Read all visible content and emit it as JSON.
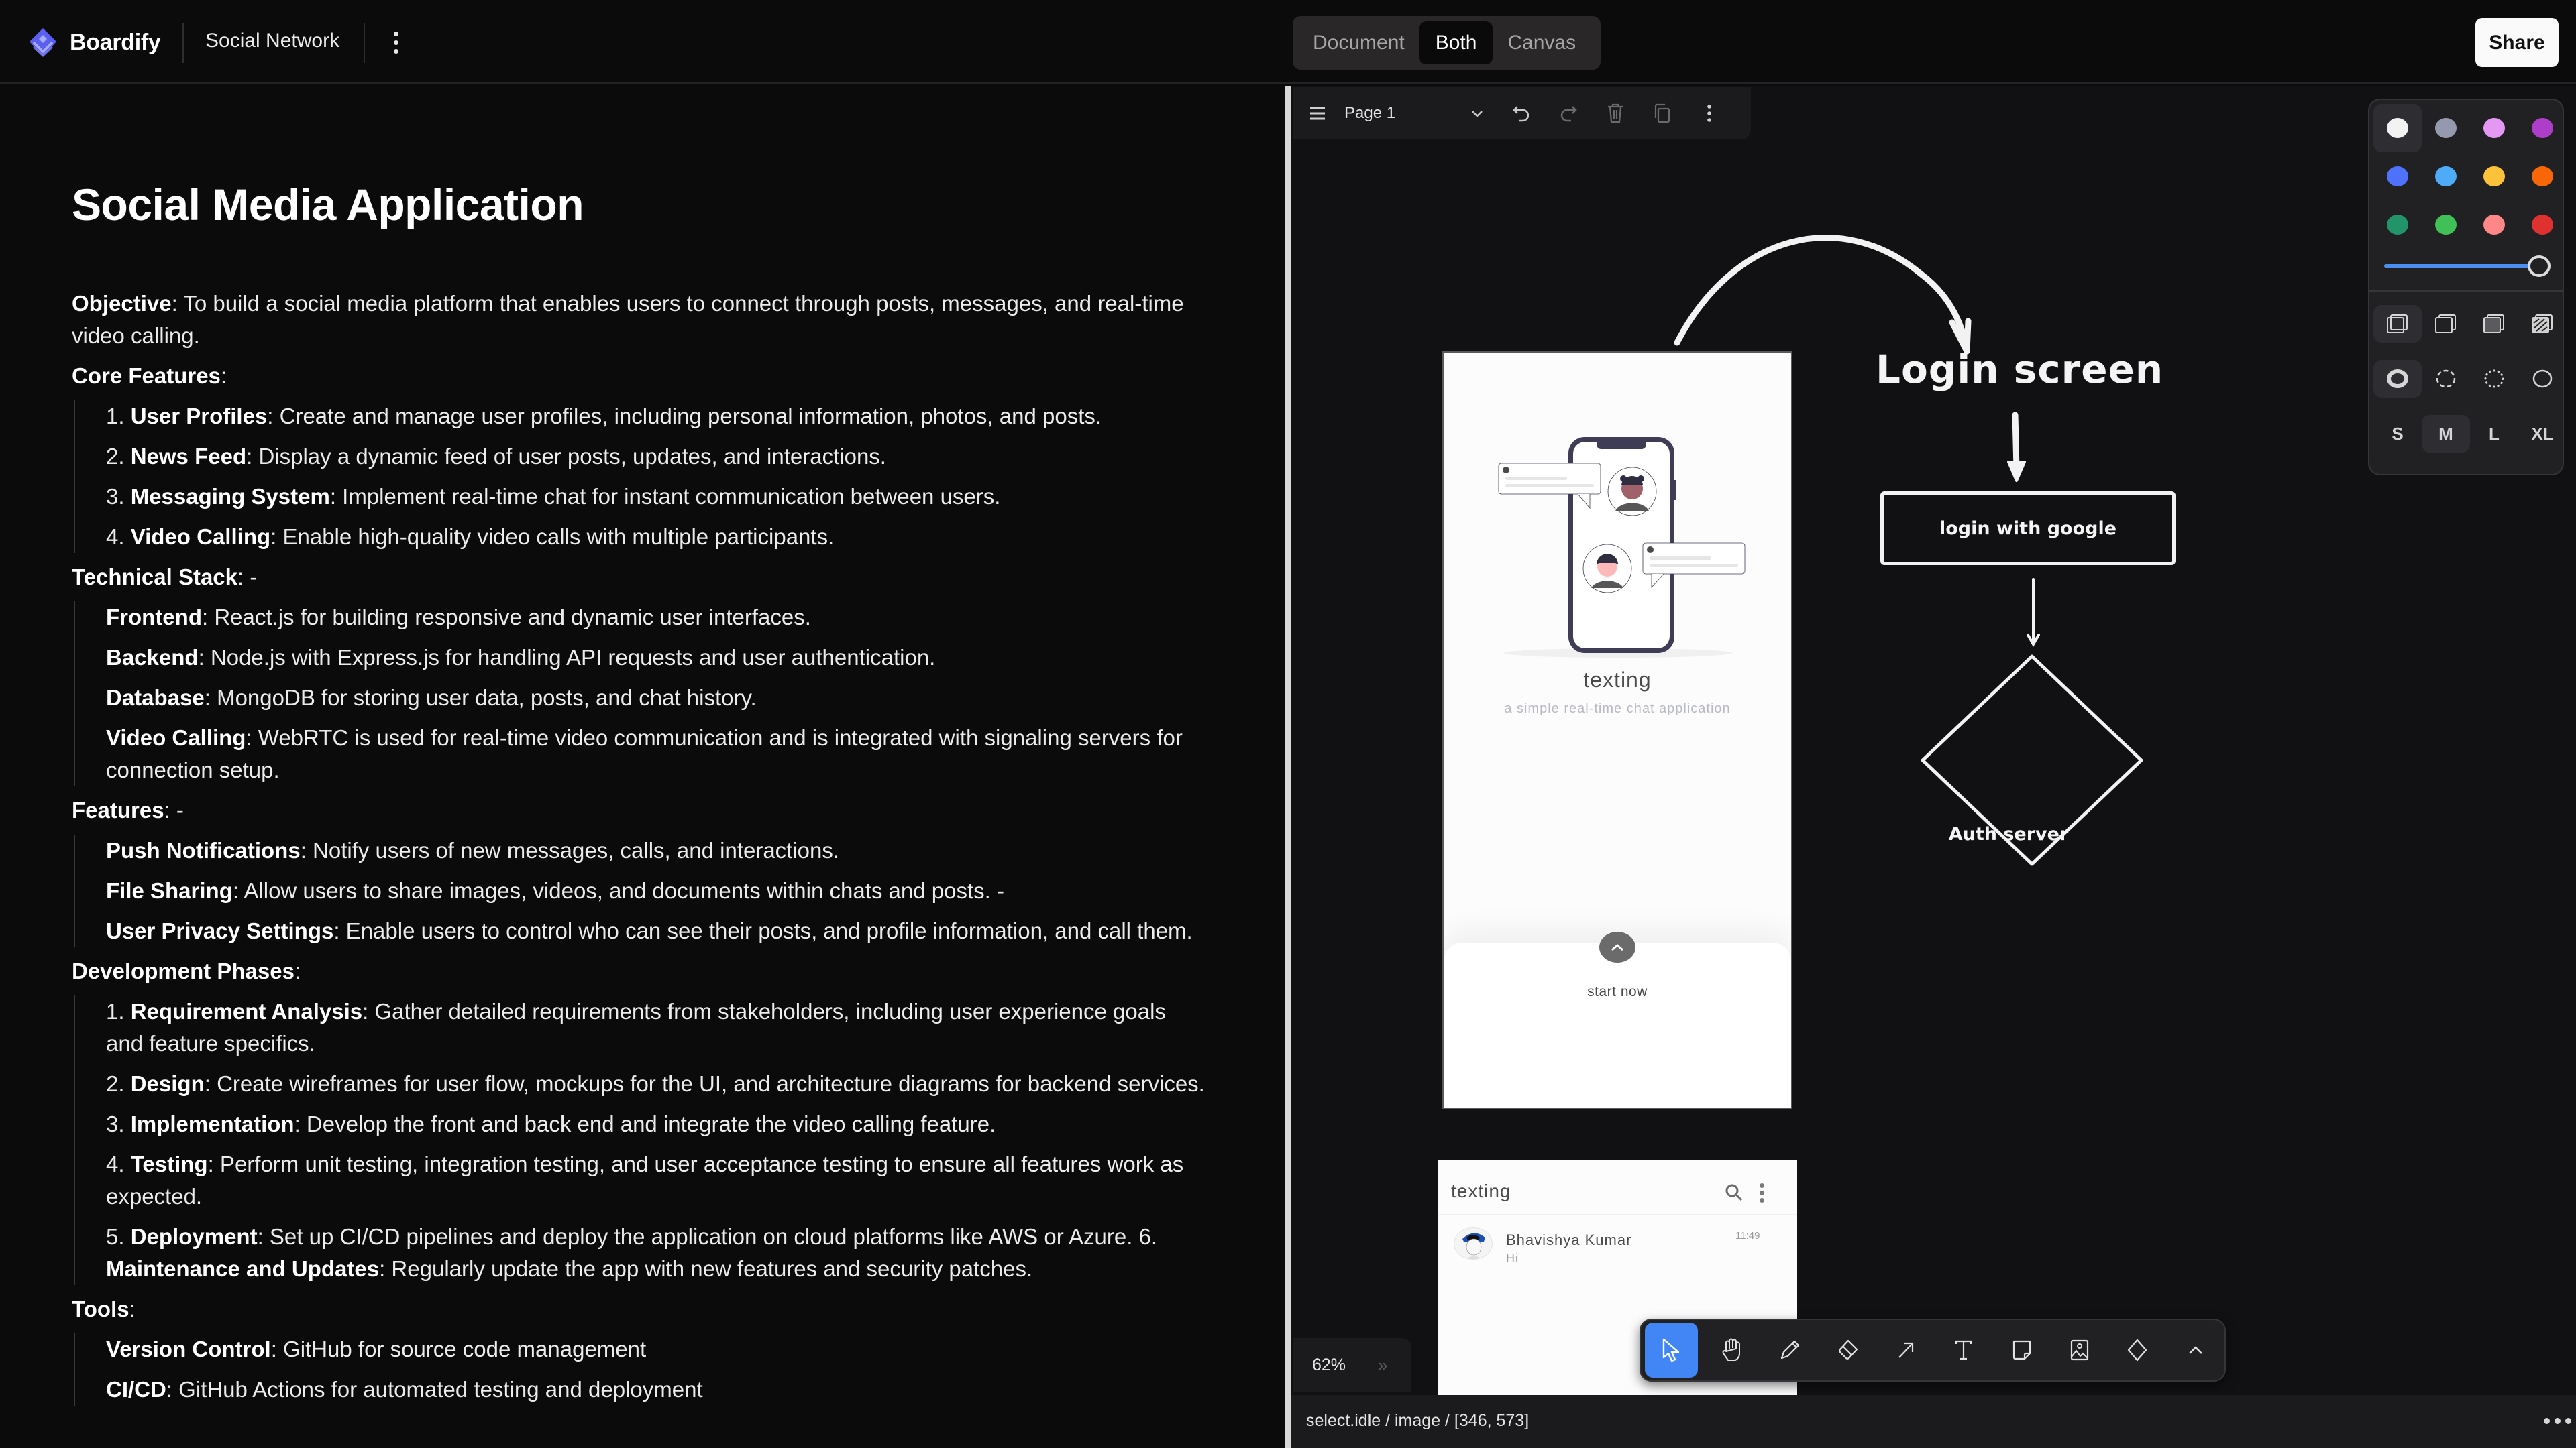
{
  "header": {
    "brand": "Boardify",
    "document_name": "Social Network",
    "view_modes": [
      "Document",
      "Both",
      "Canvas"
    ],
    "active_view": "Both",
    "share_label": "Share"
  },
  "document": {
    "title": "Social Media Application",
    "objective": {
      "label": "Objective",
      "text": ": To build a social media platform that enables users to connect through posts, messages, and real-time video calling."
    },
    "sections": [
      {
        "heading": "Core Features",
        "suffix": ":",
        "items": [
          {
            "prefix": "1. ",
            "label": "User Profiles",
            "text": ": Create and manage user profiles, including personal information, photos, and posts."
          },
          {
            "prefix": "2. ",
            "label": "News Feed",
            "text": ": Display a dynamic feed of user posts, updates, and interactions."
          },
          {
            "prefix": "3. ",
            "label": "Messaging System",
            "text": ": Implement real-time chat for instant communication between users."
          },
          {
            "prefix": "4. ",
            "label": "Video Calling",
            "text": ": Enable high-quality video calls with multiple participants."
          }
        ]
      },
      {
        "heading": "Technical Stack",
        "suffix": ": -",
        "items": [
          {
            "prefix": "",
            "label": "Frontend",
            "text": ": React.js for building responsive and dynamic user interfaces."
          },
          {
            "prefix": "",
            "label": "Backend",
            "text": ": Node.js with Express.js for handling API requests and user authentication."
          },
          {
            "prefix": "",
            "label": "Database",
            "text": ": MongoDB for storing user data, posts, and chat history."
          },
          {
            "prefix": "",
            "label": "Video Calling",
            "text": ": WebRTC is used for real-time video communication and is integrated with signaling servers for connection setup."
          }
        ]
      },
      {
        "heading": "Features",
        "suffix": ": -",
        "items": [
          {
            "prefix": "",
            "label": "Push Notifications",
            "text": ": Notify users of new messages, calls, and interactions."
          },
          {
            "prefix": "",
            "label": "File Sharing",
            "text": ": Allow users to share images, videos, and documents within chats and posts. -"
          },
          {
            "prefix": "",
            "label": "User Privacy Settings",
            "text": ": Enable users to control who can see their posts, and profile information, and call them."
          }
        ]
      },
      {
        "heading": "Development Phases",
        "suffix": ":",
        "items": [
          {
            "prefix": "1. ",
            "label": "Requirement Analysis",
            "text": ": Gather detailed requirements from stakeholders, including user experience goals and feature specifics."
          },
          {
            "prefix": "2. ",
            "label": "Design",
            "text": ": Create wireframes for user flow, mockups for the UI, and architecture diagrams for backend services."
          },
          {
            "prefix": "3. ",
            "label": "Implementation",
            "text": ": Develop the front and back end and integrate the video calling feature."
          },
          {
            "prefix": "4. ",
            "label": "Testing",
            "text": ": Perform unit testing, integration testing, and user acceptance testing to ensure all features work as expected."
          },
          {
            "prefix": "5. ",
            "label": "Deployment",
            "text": ": Set up CI/CD pipelines and deploy the application on cloud platforms like AWS or Azure. 6. ",
            "label2": "Maintenance and Updates",
            "text2": ": Regularly update the app with new features and security patches."
          }
        ]
      },
      {
        "heading": "Tools",
        "suffix": ":",
        "items": [
          {
            "prefix": "",
            "label": "Version Control",
            "text": ": GitHub for source code management"
          },
          {
            "prefix": "",
            "label": "CI/CD",
            "text": ": GitHub Actions for automated testing and deployment"
          }
        ]
      }
    ]
  },
  "canvas": {
    "page_toolbar": {
      "page_name": "Page 1",
      "icons": [
        "menu-icon",
        "chevron-down-icon",
        "undo-icon",
        "redo-icon",
        "trash-icon",
        "duplicate-icon",
        "more-icon"
      ]
    },
    "style_panel": {
      "colors": [
        {
          "name": "white",
          "hex": "#f2f2f2"
        },
        {
          "name": "grey",
          "hex": "#9599b0"
        },
        {
          "name": "light-violet",
          "hex": "#e498f4"
        },
        {
          "name": "violet",
          "hex": "#ae3ec9"
        },
        {
          "name": "blue",
          "hex": "#4f72fc"
        },
        {
          "name": "light-blue",
          "hex": "#4dabf7"
        },
        {
          "name": "yellow",
          "hex": "#fcc239"
        },
        {
          "name": "orange",
          "hex": "#f76707"
        },
        {
          "name": "green",
          "hex": "#229469"
        },
        {
          "name": "light-green",
          "hex": "#40c057"
        },
        {
          "name": "light-red",
          "hex": "#ff8787"
        },
        {
          "name": "red",
          "hex": "#e03131"
        }
      ],
      "selected_color": "white",
      "opacity_percent": 100,
      "fill_styles": [
        "none",
        "semi",
        "solid",
        "pattern"
      ],
      "selected_fill": "none",
      "dash_styles": [
        "draw",
        "dashed",
        "dotted",
        "solid"
      ],
      "selected_dash": "draw",
      "sizes": [
        "S",
        "M",
        "L",
        "XL"
      ],
      "selected_size": "M"
    },
    "phone_card": {
      "title": "texting",
      "subtitle": "a simple real-time chat application",
      "cta": "start now"
    },
    "chat_card": {
      "title": "texting",
      "contact_name": "Bhavishya Kumar",
      "last_message": "Hi",
      "time": "11:49"
    },
    "diagram": {
      "login_label": "Login screen",
      "login_button": "login with google",
      "auth_node": "Auth server"
    },
    "zoom": "62%",
    "tools": [
      "select",
      "hand",
      "draw",
      "eraser",
      "arrow",
      "text",
      "note",
      "asset",
      "geo",
      "more"
    ],
    "active_tool": "select",
    "status": "select.idle / image / [346, 573]"
  }
}
